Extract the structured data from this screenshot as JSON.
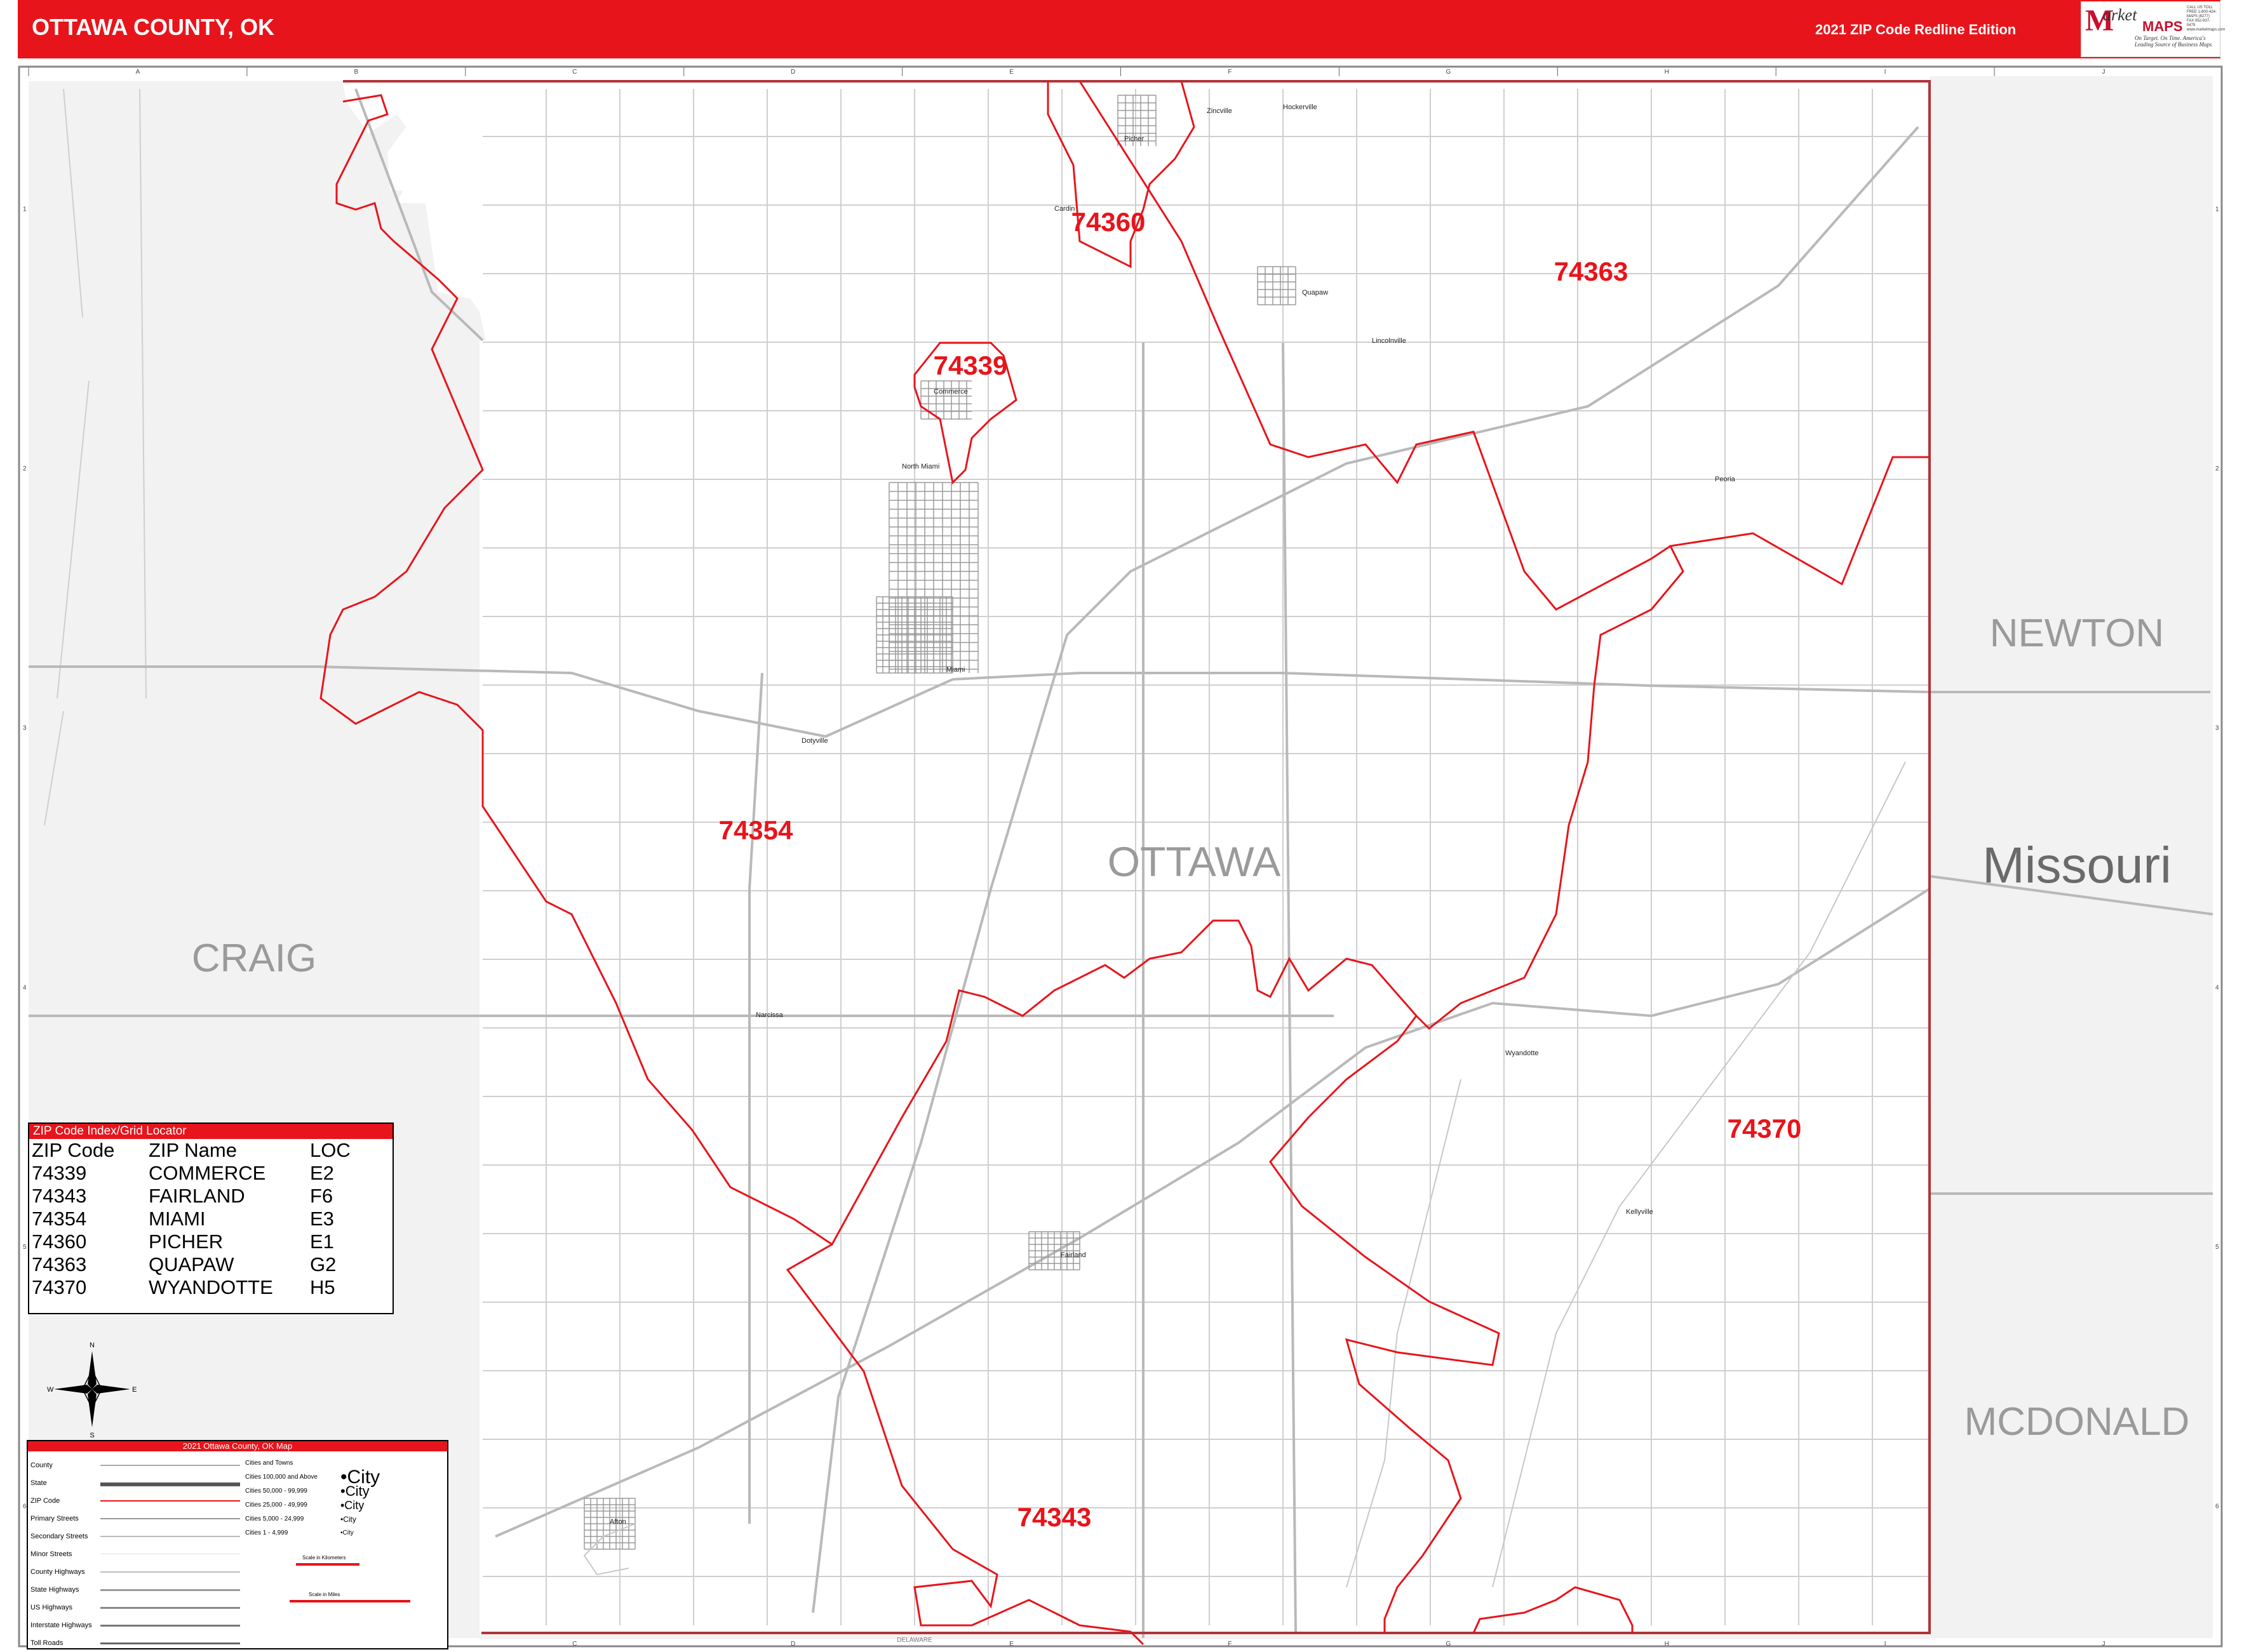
{
  "header": {
    "title": "OTTAWA COUNTY, OK",
    "edition": "2021 ZIP Code Redline Edition"
  },
  "logo": {
    "m": "M",
    "word1": "arket",
    "word2": "MAPS",
    "tagline": "On Target. On Time. America's Leading Source of Business Maps",
    "phone": "CALL US TOLL FREE 1-800-424-MAPS (6277) FAX 952-937-5479 www.marketmaps.com"
  },
  "colors": {
    "redline": "#e8141b",
    "header_bg": "#e8141b",
    "outside_gray": "#f2f2f2",
    "road_gray": "#b9b9b9",
    "label_gray": "#9a9a9a"
  },
  "grid": {
    "columns": [
      "A",
      "B",
      "C",
      "D",
      "E",
      "F",
      "G",
      "H",
      "I",
      "J"
    ],
    "rows": [
      "1",
      "2",
      "3",
      "4",
      "5",
      "6"
    ]
  },
  "regions": {
    "county": "OTTAWA",
    "state": "Missouri",
    "neighbors": [
      "CRAIG",
      "NEWTON",
      "MCDONALD",
      "DELAWARE"
    ]
  },
  "zip_labels": [
    "74360",
    "74363",
    "74339",
    "74354",
    "74370",
    "74343"
  ],
  "places": [
    "Zincville",
    "Hockerville",
    "Picher",
    "Cardin",
    "Quapaw",
    "Lincolnville",
    "Commerce",
    "North Miami",
    "Peoria",
    "Miami",
    "Dotyville",
    "Narcissa",
    "Wyandotte",
    "Kellyville",
    "Fairland",
    "Afton"
  ],
  "zip_table": {
    "heading": "ZIP Code Index/Grid Locator",
    "columns": [
      "ZIP Code",
      "ZIP Name",
      "LOC"
    ],
    "rows": [
      [
        "74339",
        "COMMERCE",
        "E2"
      ],
      [
        "74343",
        "FAIRLAND",
        "F6"
      ],
      [
        "74354",
        "MIAMI",
        "E3"
      ],
      [
        "74360",
        "PICHER",
        "E1"
      ],
      [
        "74363",
        "QUAPAW",
        "G2"
      ],
      [
        "74370",
        "WYANDOTTE",
        "H5"
      ]
    ]
  },
  "compass": {
    "n": "N",
    "s": "S",
    "e": "E",
    "w": "W"
  },
  "legend": {
    "heading": "2021 Ottawa County, OK Map",
    "items": [
      "County",
      "State",
      "ZIP Code",
      "Primary Streets",
      "Secondary Streets",
      "Minor Streets",
      "County Highways",
      "State Highways",
      "US Highways",
      "Interstate Highways",
      "Toll Roads"
    ],
    "cities_heading": "Cities and Towns",
    "city_classes": [
      {
        "range": "Cities 100,000 and Above",
        "sample": "•City"
      },
      {
        "range": "Cities 50,000 - 99,999",
        "sample": "•City"
      },
      {
        "range": "Cities 25,000 - 49,999",
        "sample": "•City"
      },
      {
        "range": "Cities 5,000 - 24,999",
        "sample": "•City"
      },
      {
        "range": "Cities 1 - 4,999",
        "sample": "•City"
      }
    ],
    "scale_km": "Scale in Kilometers",
    "scale_mi": "Scale in Miles"
  }
}
